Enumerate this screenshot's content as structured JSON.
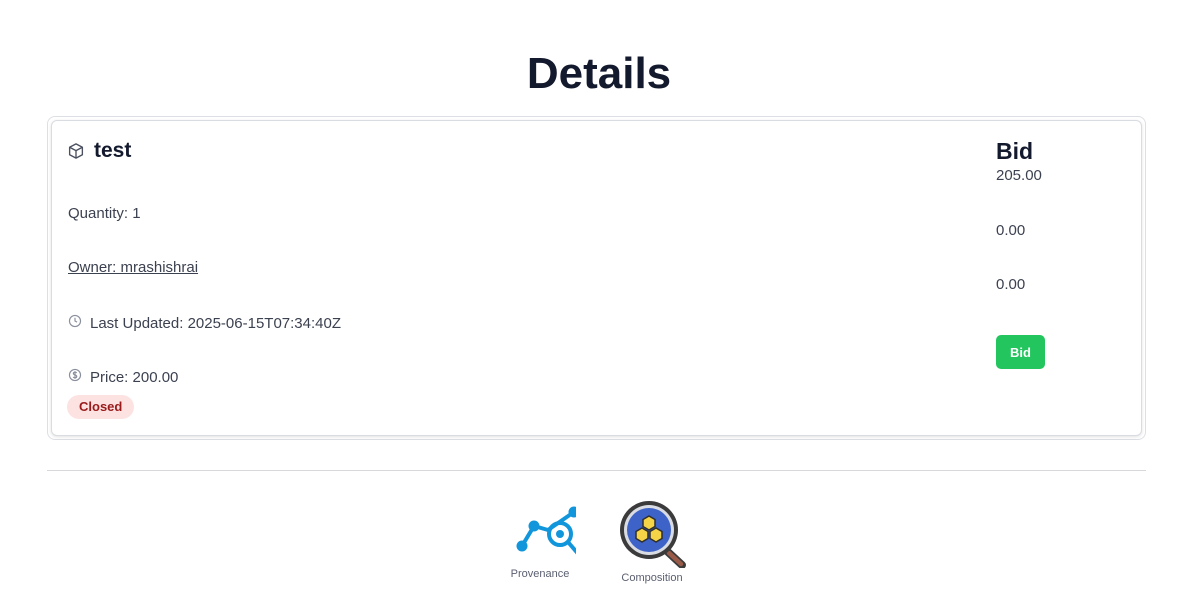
{
  "page": {
    "title": "Details"
  },
  "item": {
    "name": "test",
    "quantity": "Quantity: 1",
    "owner": "Owner: mrashishrai",
    "last_updated": "Last Updated: 2025-06-15T07:34:40Z",
    "price": "Price: 200.00",
    "status": "Closed"
  },
  "bid": {
    "heading": "Bid",
    "values": [
      "205.00",
      "0.00",
      "0.00"
    ],
    "button_label": "Bid"
  },
  "tools": [
    {
      "label": "Provenance",
      "icon": "provenance-icon"
    },
    {
      "label": "Composition",
      "icon": "composition-icon"
    }
  ],
  "colors": {
    "bid_button": "#22c55e",
    "badge_bg": "#fde2e2",
    "badge_text": "#991b1b",
    "provenance_blue": "#1296db",
    "composition_blue": "#3e63c8",
    "composition_hex": "#f5d547"
  }
}
